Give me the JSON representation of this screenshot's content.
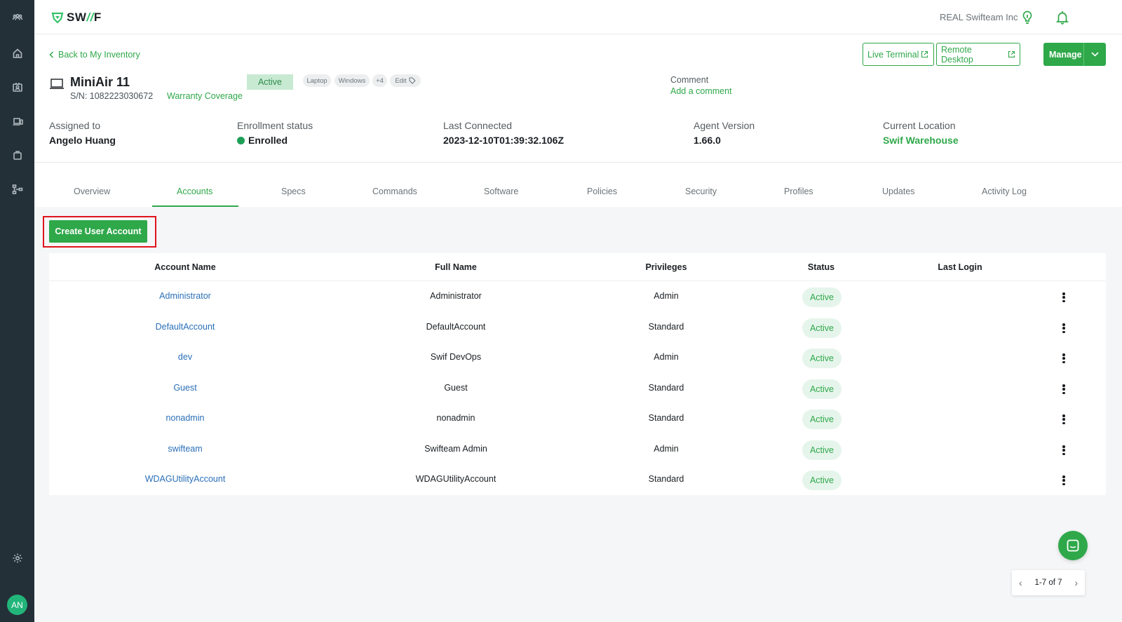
{
  "sidebar": {
    "items": [
      {
        "name": "team-icon"
      },
      {
        "name": "home-icon"
      },
      {
        "name": "users-icon"
      },
      {
        "name": "devices-icon"
      },
      {
        "name": "apps-icon"
      },
      {
        "name": "workflow-icon"
      }
    ],
    "settings_icon": "gear-icon",
    "avatar_initials": "AN"
  },
  "topbar": {
    "logo_text": "SW",
    "logo_slash": "//",
    "logo_end": "F",
    "org_name": "REAL Swifteam Inc"
  },
  "header": {
    "back_label": "Back to My Inventory",
    "live_terminal": "Live Terminal",
    "remote_desktop": "Remote Desktop",
    "manage": "Manage",
    "device_name": "MiniAir 11",
    "serial": "S/N: 1082223030672",
    "warranty": "Warranty Coverage",
    "status": "Active",
    "tags": [
      "Laptop",
      "Windows",
      "+4",
      "Edit"
    ],
    "comment_label": "Comment",
    "comment_add": "Add a comment"
  },
  "info": {
    "assigned_label": "Assigned to",
    "assigned_value": "Angelo Huang",
    "enrollment_label": "Enrollment status",
    "enrollment_value": "Enrolled",
    "last_connected_label": "Last Connected",
    "last_connected_value": "2023-12-10T01:39:32.106Z",
    "agent_label": "Agent Version",
    "agent_value": "1.66.0",
    "location_label": "Current Location",
    "location_value": "Swif Warehouse"
  },
  "tabs": [
    "Overview",
    "Accounts",
    "Specs",
    "Commands",
    "Software",
    "Policies",
    "Security",
    "Profiles",
    "Updates",
    "Activity Log"
  ],
  "active_tab": "Accounts",
  "accounts": {
    "create_button": "Create User Account",
    "columns": [
      "Account Name",
      "Full Name",
      "Privileges",
      "Status",
      "Last Login"
    ],
    "rows": [
      {
        "account": "Administrator",
        "full_name": "Administrator",
        "privileges": "Admin",
        "status": "Active",
        "last_login": ""
      },
      {
        "account": "DefaultAccount",
        "full_name": "DefaultAccount",
        "privileges": "Standard",
        "status": "Active",
        "last_login": ""
      },
      {
        "account": "dev",
        "full_name": "Swif DevOps",
        "privileges": "Admin",
        "status": "Active",
        "last_login": ""
      },
      {
        "account": "Guest",
        "full_name": "Guest",
        "privileges": "Standard",
        "status": "Active",
        "last_login": ""
      },
      {
        "account": "nonadmin",
        "full_name": "nonadmin",
        "privileges": "Standard",
        "status": "Active",
        "last_login": ""
      },
      {
        "account": "swifteam",
        "full_name": "Swifteam Admin",
        "privileges": "Admin",
        "status": "Active",
        "last_login": ""
      },
      {
        "account": "WDAGUtilityAccount",
        "full_name": "WDAGUtilityAccount",
        "privileges": "Standard",
        "status": "Active",
        "last_login": ""
      }
    ]
  },
  "pagination": {
    "label": "1-7 of 7"
  },
  "colors": {
    "accent": "#2fa84a",
    "sidebar": "#243038",
    "link": "#2a6fb8",
    "highlight": "#e0141c"
  }
}
